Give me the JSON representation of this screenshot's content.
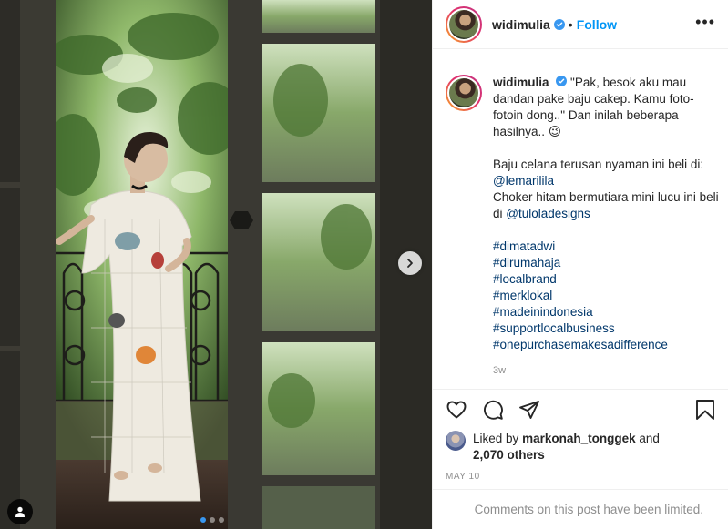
{
  "post": {
    "username": "widimulia",
    "follow_label": "Follow",
    "separator": "•",
    "more_label": "•••"
  },
  "caption": {
    "username": "widimulia",
    "line1": "\"Pak, besok aku mau dandan pake baju cakep. Kamu foto-fotoin dong..\" Dan inilah beberapa hasilnya..",
    "emoji": "😉",
    "line2_prefix": "Baju celana terusan nyaman ini beli di:",
    "line2_mention": "@lemarilila",
    "line3_prefix": "Choker hitam bermutiara mini lucu ini beli di",
    "line3_mention": "@tuloladesigns",
    "hashtags": [
      "#dimatadwi",
      "#dirumahaja",
      "#localbrand",
      "#merklokal",
      "#madeinindonesia",
      "#supportlocalbusiness",
      "#onepurchasemakesadifference"
    ],
    "time": "3w"
  },
  "likes": {
    "prefix": "Liked by",
    "user": "markonah_tonggek",
    "conj": "and",
    "others": "2,070 others"
  },
  "date": "MAY 10",
  "comments_limited": "Comments on this post have been limited.",
  "carousel": {
    "total": 3,
    "active_index": 0
  },
  "colors": {
    "accent": "#0095f6",
    "link": "#00376b",
    "muted": "#8e8e8e",
    "verified": "#3897f0"
  },
  "icons": [
    "verified-badge-icon",
    "heart-icon",
    "comment-icon",
    "share-icon",
    "bookmark-icon",
    "chevron-right-icon",
    "user-tag-icon"
  ]
}
